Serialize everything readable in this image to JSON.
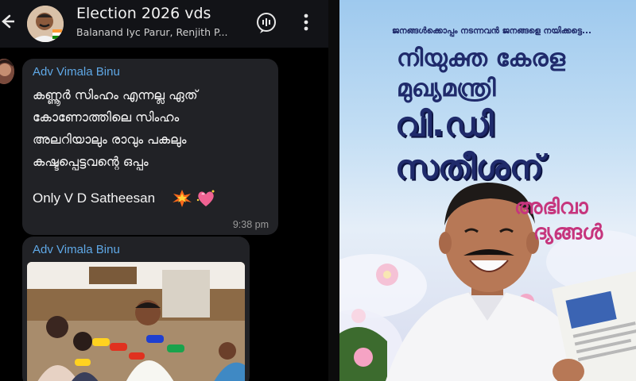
{
  "chat": {
    "header": {
      "title": "Election 2026 vds",
      "members": "Balanand Iyc Parur, Renjith P..."
    },
    "messages": [
      {
        "sender": "Adv Vimala Binu",
        "lines": [
          "കണ്ണൂർ സിംഹം എന്നല്ല ഏത്",
          "കോണോത്തിലെ സിംഹം",
          "അലറിയാലും രാവും പകലും",
          "കഷ്ടപ്പെട്ടവന്റെ ഒപ്പം"
        ],
        "closing": "Only V D Satheesan",
        "emojis": [
          "collision-emoji",
          "sparkling-heart-emoji"
        ],
        "time": "9:38 pm"
      },
      {
        "sender": "Adv Vimala Binu",
        "attachment": "photo-press-interview"
      }
    ],
    "icons": [
      "back-arrow-icon",
      "voice-chat-icon",
      "more-vert-icon"
    ]
  },
  "poster": {
    "tagline": "ജനങ്ങൾക്കൊപ്പം നടന്നവൻ ജനങ്ങളെ നയിക്കട്ടെ...",
    "line1": "നിയുക്ത കേരള",
    "line2": "മുഖ്യമന്ത്രി",
    "name1": "വി.ഡി",
    "name2": "സതീശന്",
    "greet1": "അഭിവാ",
    "greet2": "ദ്യങ്ങൾ"
  },
  "colors": {
    "chat_bg": "#000000",
    "bubble": "#212226",
    "sender": "#5fa8e6",
    "poster_text": "#1f2a6b",
    "poster_accent": "#c6357d"
  }
}
